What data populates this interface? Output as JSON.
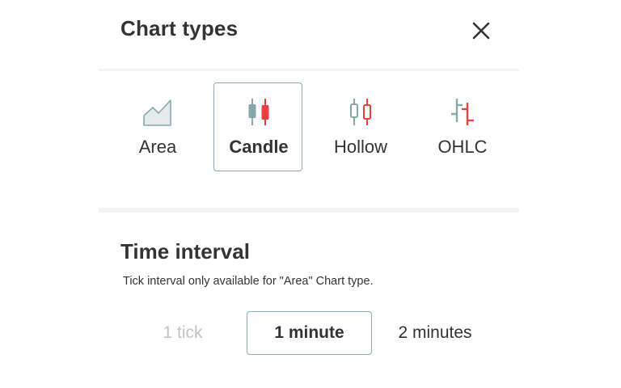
{
  "header": {
    "title": "Chart types",
    "close_icon": "close-icon"
  },
  "chart_types": [
    {
      "label": "Area",
      "icon": "area-chart-icon",
      "selected": false
    },
    {
      "label": "Candle",
      "icon": "candle-chart-icon",
      "selected": true
    },
    {
      "label": "Hollow",
      "icon": "hollow-candle-chart-icon",
      "selected": false
    },
    {
      "label": "OHLC",
      "icon": "ohlc-chart-icon",
      "selected": false
    }
  ],
  "time_interval": {
    "title": "Time interval",
    "note": "Tick interval only available for \"Area\" Chart type.",
    "options": [
      {
        "label": "1 tick",
        "disabled": true,
        "selected": false
      },
      {
        "label": "1 minute",
        "disabled": false,
        "selected": true
      },
      {
        "label": "2 minutes",
        "disabled": false,
        "selected": false
      }
    ]
  },
  "colors": {
    "accent_border": "#85acb0",
    "icon_teal": "#85a9ab",
    "icon_red": "#ec3f3f",
    "divider": "#f2f3f4",
    "disabled_text": "#c2c2c2"
  }
}
